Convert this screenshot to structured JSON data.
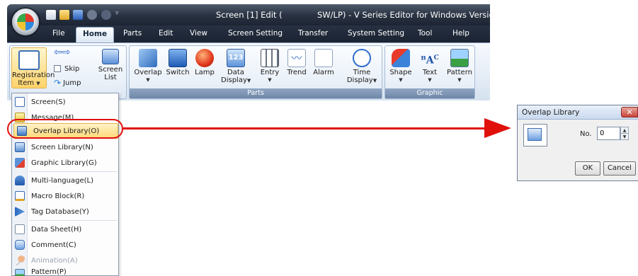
{
  "window": {
    "title_left": "Screen [1] Edit (",
    "title_right": "SW/LP) - V Series Editor for Windows Version"
  },
  "tabs": [
    "File",
    "Home",
    "Parts",
    "Edit",
    "View",
    "Screen Setting",
    "Transfer",
    "System Setting",
    "Tool",
    "Help"
  ],
  "ribbon": {
    "registration_item": {
      "line1": "Registration",
      "line2": "Item"
    },
    "skip": "Skip",
    "jump": "Jump",
    "screen_list": {
      "line1": "Screen",
      "line2": "List"
    },
    "parts_buttons": {
      "overlap": "Overlap",
      "switch": "Switch",
      "lamp": "Lamp",
      "data_display": {
        "line1": "Data",
        "line2": "Display"
      },
      "entry": "Entry",
      "trend": "Trend",
      "alarm": "Alarm",
      "time_display": {
        "line1": "Time",
        "line2": "Display"
      }
    },
    "graphic_buttons": {
      "shape": "Shape",
      "text": "Text",
      "pattern": "Pattern"
    },
    "group_labels": {
      "parts": "Parts",
      "graphic": "Graphic"
    }
  },
  "menu": {
    "items": [
      "Screen(S)",
      "Message(M)",
      "Overlap Library(O)",
      "Screen Library(N)",
      "Graphic Library(G)",
      "Multi-language(L)",
      "Macro Block(R)",
      "Tag Database(Y)",
      "Data Sheet(H)",
      "Comment(C)",
      "Animation(A)",
      "Pattern(P)"
    ],
    "highlighted_item": "Overlap Library(O)",
    "disabled_item": "Animation(A)"
  },
  "dialog": {
    "title": "Overlap Library",
    "no_label": "No.",
    "no_value": "0",
    "ok": "OK",
    "cancel": "Cancel"
  },
  "colors": {
    "callout": "#e0100b",
    "ribbon_group_label": "#7b92b3",
    "menu_highlight": "#ffd978"
  }
}
